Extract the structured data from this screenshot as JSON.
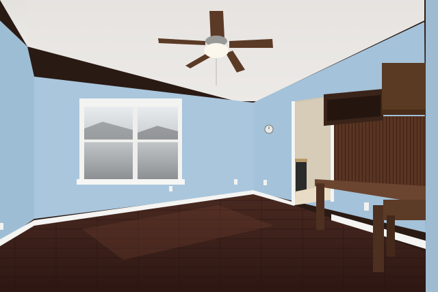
{
  "scene": {
    "subject": "empty-room-interior",
    "colors": {
      "ceiling": "#eceae6",
      "wall_blue": "#a9c6dc",
      "wall_blue_shadow": "#93b3cb",
      "floor_dark": "#3a1f19",
      "floor_light": "#5a3328",
      "trim": "#f4f4f2",
      "wood_cabinet": "#5a3a22",
      "wood_desk": "#6b4530",
      "hallway": "#cfc6b2"
    }
  }
}
